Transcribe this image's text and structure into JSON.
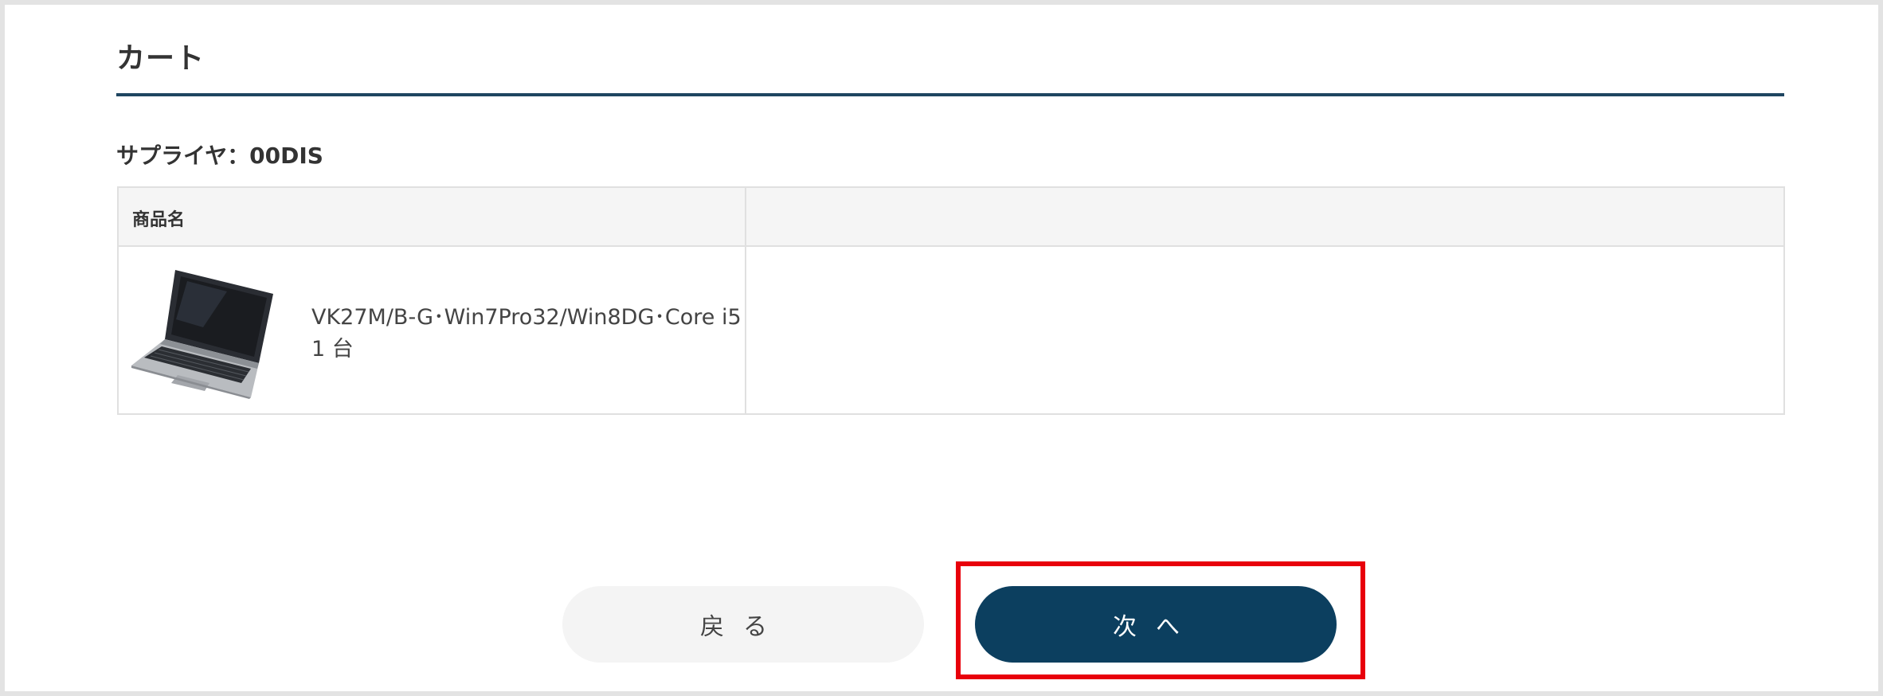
{
  "page": {
    "title": "カート"
  },
  "supplier": {
    "label": "サプライヤ：00DIS"
  },
  "cart_table": {
    "columns": [
      "商品名",
      ""
    ],
    "items": [
      {
        "image": "laptop-image",
        "name": "VK27M/B-G･Win7Pro32/Win8DG･Core i5",
        "quantity": "1 台"
      }
    ]
  },
  "buttons": {
    "back_label": "戻る",
    "next_label": "次へ"
  },
  "colors": {
    "accent": "#0c3f5f",
    "highlight": "#e8000b",
    "rule": "#1f4560"
  }
}
